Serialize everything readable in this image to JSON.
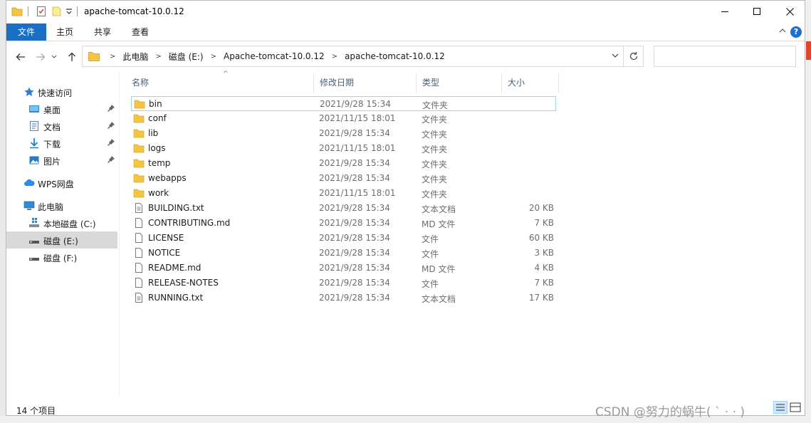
{
  "window": {
    "title": "apache-tomcat-10.0.12",
    "qa_dropdown_icon": "chevron-down-icon"
  },
  "ribbon": {
    "tabs": [
      "文件",
      "主页",
      "共享",
      "查看"
    ],
    "help": "?"
  },
  "address": {
    "crumbs": [
      "此电脑",
      "磁盘 (E:)",
      "Apache-tomcat-10.0.12",
      "apache-tomcat-10.0.12"
    ],
    "search_placeholder": ""
  },
  "nav": {
    "items": [
      {
        "label": "快速访问",
        "icon": "star-icon"
      },
      {
        "label": "桌面",
        "icon": "desktop-icon",
        "pinned": true
      },
      {
        "label": "文档",
        "icon": "documents-icon",
        "pinned": true
      },
      {
        "label": "下载",
        "icon": "download-icon",
        "pinned": true
      },
      {
        "label": "图片",
        "icon": "pictures-icon",
        "pinned": true
      },
      {
        "label": "WPS网盘",
        "icon": "cloud-icon"
      },
      {
        "label": "此电脑",
        "icon": "computer-icon"
      },
      {
        "label": "本地磁盘 (C:)",
        "icon": "windows-drive-icon"
      },
      {
        "label": "磁盘 (E:)",
        "icon": "drive-icon",
        "selected": true
      },
      {
        "label": "磁盘 (F:)",
        "icon": "drive-icon"
      }
    ]
  },
  "columns": {
    "name": "名称",
    "date": "修改日期",
    "type": "类型",
    "size": "大小"
  },
  "files": [
    {
      "name": "bin",
      "date": "2021/9/28 15:34",
      "type": "文件夹",
      "size": "",
      "kind": "folder"
    },
    {
      "name": "conf",
      "date": "2021/11/15 18:01",
      "type": "文件夹",
      "size": "",
      "kind": "folder"
    },
    {
      "name": "lib",
      "date": "2021/9/28 15:34",
      "type": "文件夹",
      "size": "",
      "kind": "folder"
    },
    {
      "name": "logs",
      "date": "2021/11/15 18:01",
      "type": "文件夹",
      "size": "",
      "kind": "folder"
    },
    {
      "name": "temp",
      "date": "2021/9/28 15:34",
      "type": "文件夹",
      "size": "",
      "kind": "folder"
    },
    {
      "name": "webapps",
      "date": "2021/9/28 15:34",
      "type": "文件夹",
      "size": "",
      "kind": "folder"
    },
    {
      "name": "work",
      "date": "2021/11/15 18:01",
      "type": "文件夹",
      "size": "",
      "kind": "folder"
    },
    {
      "name": "BUILDING.txt",
      "date": "2021/9/28 15:34",
      "type": "文本文档",
      "size": "20 KB",
      "kind": "text"
    },
    {
      "name": "CONTRIBUTING.md",
      "date": "2021/9/28 15:34",
      "type": "MD 文件",
      "size": "7 KB",
      "kind": "file"
    },
    {
      "name": "LICENSE",
      "date": "2021/9/28 15:34",
      "type": "文件",
      "size": "60 KB",
      "kind": "file"
    },
    {
      "name": "NOTICE",
      "date": "2021/9/28 15:34",
      "type": "文件",
      "size": "3 KB",
      "kind": "file"
    },
    {
      "name": "README.md",
      "date": "2021/9/28 15:34",
      "type": "MD 文件",
      "size": "4 KB",
      "kind": "file"
    },
    {
      "name": "RELEASE-NOTES",
      "date": "2021/9/28 15:34",
      "type": "文件",
      "size": "7 KB",
      "kind": "file"
    },
    {
      "name": "RUNNING.txt",
      "date": "2021/9/28 15:34",
      "type": "文本文档",
      "size": "17 KB",
      "kind": "text"
    }
  ],
  "status": {
    "count": "14 个项目"
  },
  "watermark": "CSDN @努力的蜗牛(  ˋ ·  ·   )",
  "colors": {
    "file_tab": "#1a6fc4",
    "folder": "#f5c542",
    "selected_nav": "#d9d9d9",
    "focus_border": "#99d1ff",
    "header_text": "#4c607a"
  }
}
